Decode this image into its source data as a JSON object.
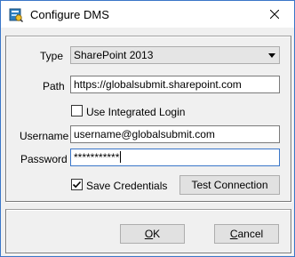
{
  "window": {
    "title": "Configure DMS"
  },
  "form": {
    "type_label": "Type",
    "type_value": "SharePoint 2013",
    "path_label": "Path",
    "path_value": "https://globalsubmit.sharepoint.com",
    "integrated_login_label": "Use Integrated Login",
    "integrated_login_checked": false,
    "username_label": "Username",
    "username_value": "username@globalsubmit.com",
    "password_label": "Password",
    "password_value": "***********",
    "save_credentials_label": "Save Credentials",
    "save_credentials_checked": true,
    "test_connection_label": "Test Connection"
  },
  "buttons": {
    "ok_mnemonic": "O",
    "ok_rest": "K",
    "cancel_mnemonic": "C",
    "cancel_rest": "ancel"
  },
  "colors": {
    "accent_border": "#3a76c8",
    "dialog_bg": "#f0f0f0",
    "button_bg": "#e1e1e1"
  },
  "icons": {
    "app": "dms-app-icon",
    "close": "close-icon",
    "dropdown": "chevron-down-icon",
    "check": "checkmark-icon"
  }
}
